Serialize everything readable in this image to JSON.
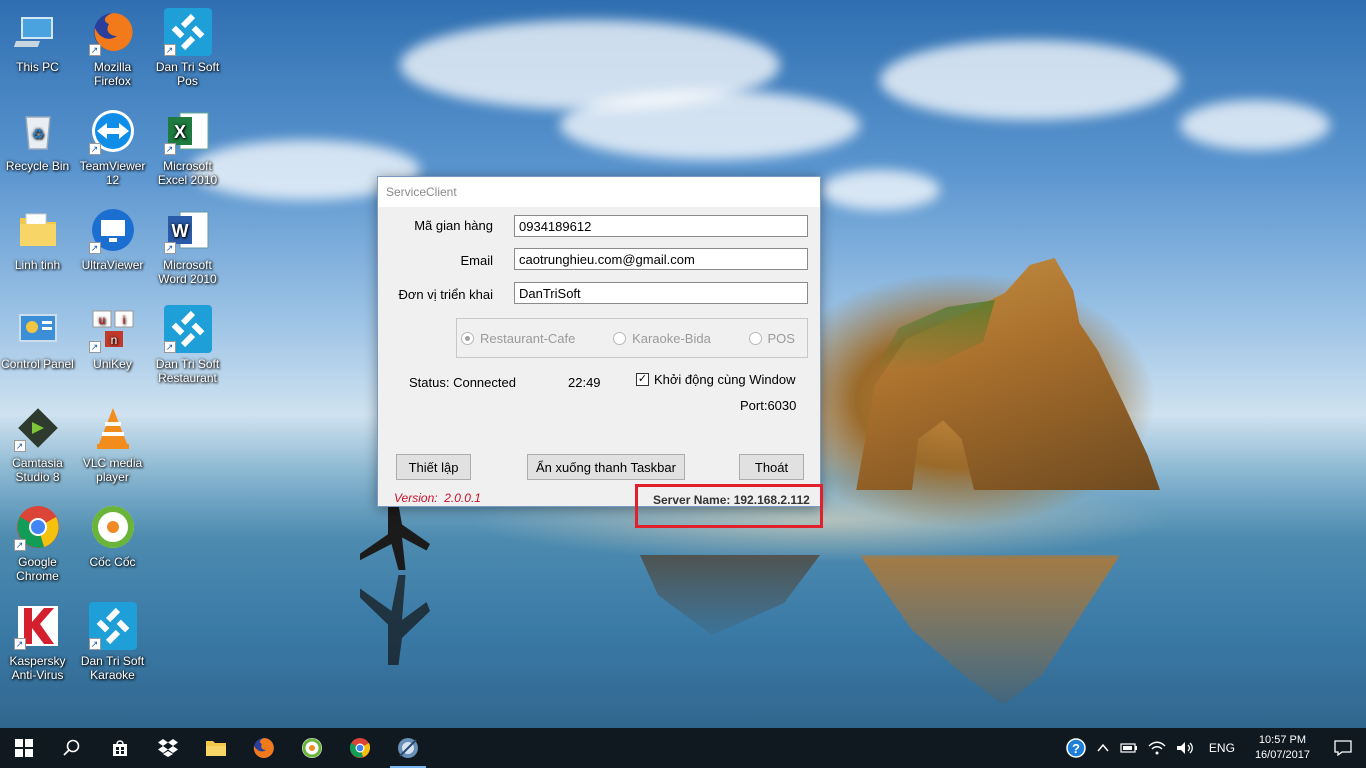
{
  "desktop": {
    "icons": [
      {
        "label": "This PC",
        "icon": "computer-icon"
      },
      {
        "label": "Mozilla Firefox",
        "icon": "firefox-icon"
      },
      {
        "label": "Dan Tri Soft Pos",
        "icon": "dantrisoft-icon"
      },
      {
        "label": "Recycle Bin",
        "icon": "recycle-bin-icon"
      },
      {
        "label": "TeamViewer 12",
        "icon": "teamviewer-icon"
      },
      {
        "label": "Microsoft Excel 2010",
        "icon": "excel-icon"
      },
      {
        "label": "Linh tinh",
        "icon": "folder-icon"
      },
      {
        "label": "UltraViewer",
        "icon": "ultraviewer-icon"
      },
      {
        "label": "Microsoft Word 2010",
        "icon": "word-icon"
      },
      {
        "label": "Control Panel",
        "icon": "control-panel-icon"
      },
      {
        "label": "UniKey",
        "icon": "unikey-icon"
      },
      {
        "label": "Dan Tri Soft Restaurant",
        "icon": "dantrisoft-icon"
      },
      {
        "label": "Camtasia Studio 8",
        "icon": "camtasia-icon"
      },
      {
        "label": "VLC media player",
        "icon": "vlc-icon"
      },
      {
        "label": "Google Chrome",
        "icon": "chrome-icon"
      },
      {
        "label": "Cốc Cốc",
        "icon": "coccoc-icon"
      },
      {
        "label": "Kaspersky Anti-Virus",
        "icon": "kaspersky-icon"
      },
      {
        "label": "Dan Tri Soft Karaoke",
        "icon": "dantrisoft-icon"
      }
    ]
  },
  "dialog": {
    "title": "ServiceClient",
    "fields": {
      "store_label": "Mã gian hàng",
      "store_value": "0934189612",
      "email_label": "Email",
      "email_value": "caotrunghieu.com@gmail.com",
      "unit_label": "Đơn vị triển khai",
      "unit_value": "DanTriSoft"
    },
    "modes": [
      {
        "label": "Restaurant-Cafe",
        "checked": true
      },
      {
        "label": "Karaoke-Bida",
        "checked": false
      },
      {
        "label": "POS",
        "checked": false
      }
    ],
    "status_text": "Status: Connected",
    "time": "22:49",
    "autostart_label": "Khởi động cùng Window",
    "autostart_checked": true,
    "port_text": "Port:6030",
    "buttons": {
      "setup": "Thiết lập",
      "minimize": "Ẩn xuống thanh Taskbar",
      "exit": "Thoát"
    },
    "version_label": "Version:",
    "version_value": "2.0.0.1",
    "server_name": "Server Name: 192.168.2.112",
    "highlight_color": "#e0202a"
  },
  "taskbar": {
    "apps": [
      "start-icon",
      "search-icon",
      "store-icon",
      "dropbox-icon",
      "file-explorer-icon",
      "firefox-icon",
      "coccoc-icon",
      "chrome-icon",
      "service-client-icon"
    ],
    "language": "ENG",
    "time": "10:57 PM",
    "date": "16/07/2017"
  }
}
